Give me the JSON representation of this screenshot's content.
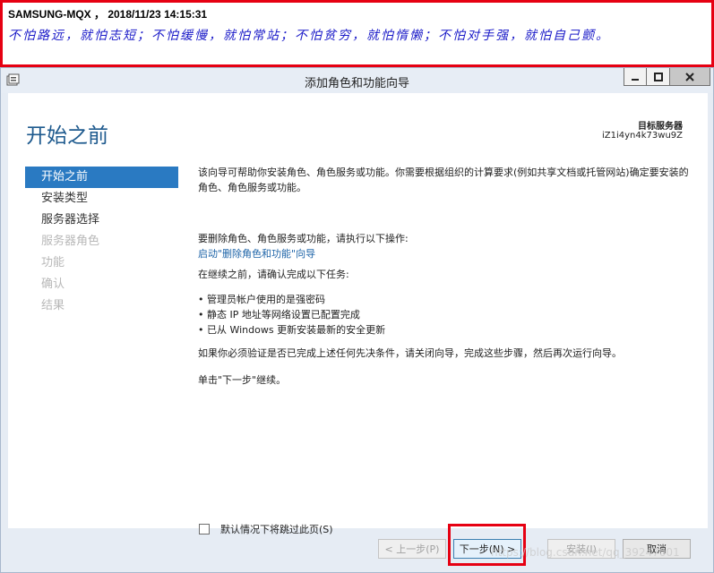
{
  "banner": {
    "line1": "SAMSUNG-MQX ， 2018/11/23 14:15:31",
    "line2": "不怕路远，就怕志短；不怕缓慢，就怕常站；不怕贫穷，就怕惰懒；不怕对手强，就怕自己颤。"
  },
  "window": {
    "title": "添加角色和功能向导"
  },
  "page": {
    "title": "开始之前",
    "target_label": "目标服务器",
    "target_value": "iZ1i4yn4k73wu9Z"
  },
  "nav": {
    "items": [
      {
        "label": "开始之前",
        "state": "active"
      },
      {
        "label": "安装类型",
        "state": "normal"
      },
      {
        "label": "服务器选择",
        "state": "normal"
      },
      {
        "label": "服务器角色",
        "state": "disabled"
      },
      {
        "label": "功能",
        "state": "disabled"
      },
      {
        "label": "确认",
        "state": "disabled"
      },
      {
        "label": "结果",
        "state": "disabled"
      }
    ]
  },
  "main": {
    "para1": "该向导可帮助你安装角色、角色服务或功能。你需要根据组织的计算要求(例如共享文档或托管网站)确定要安装的角色、角色服务或功能。",
    "para2": "要删除角色、角色服务或功能，请执行以下操作:",
    "link": "启动\"删除角色和功能\"向导",
    "para3": "在继续之前，请确认完成以下任务:",
    "bullets": [
      "• 管理员帐户使用的是强密码",
      "• 静态 IP 地址等网络设置已配置完成",
      "• 已从 Windows 更新安装最新的安全更新"
    ],
    "para4": "如果你必须验证是否已完成上述任何先决条件，请关闭向导，完成这些步骤，然后再次运行向导。",
    "para5": "单击\"下一步\"继续。"
  },
  "skip_checkbox": {
    "label": "默认情况下将跳过此页(S)",
    "checked": false
  },
  "buttons": {
    "prev": "< 上一步(P)",
    "next": "下一步(N) >",
    "install": "安装(I)",
    "cancel": "取消"
  },
  "watermark": "https://blog.csdn.net/qq_39247001",
  "colors": {
    "accent": "#2a7ac2",
    "title": "#1e5a8e",
    "highlight": "#e60012"
  }
}
